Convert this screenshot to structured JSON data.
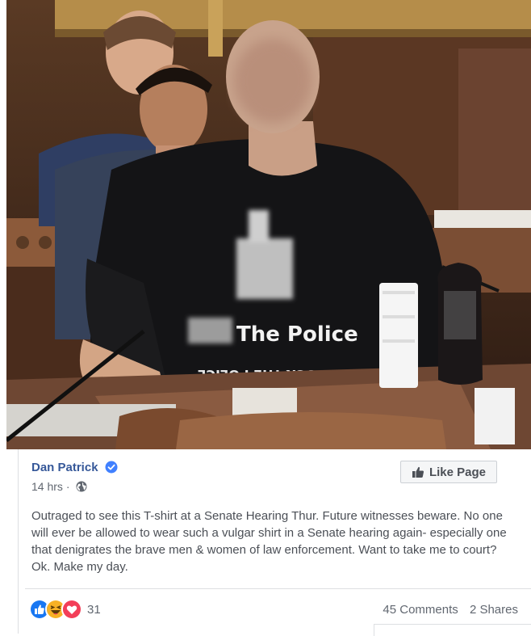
{
  "post": {
    "author": "Dan Patrick",
    "timestamp": "14 hrs",
    "separator": "·",
    "privacy_icon": "globe-icon",
    "verified_icon": "verified-badge-icon",
    "like_page_label": "Like Page",
    "text": "Outraged to see this T-shirt at a Senate Hearing Thur. Future witnesses beware. No one will ever be allowed to wear such a vulgar shirt in a Senate hearing again- especially one that denigrates the brave men & women of law enforcement. Want to take me to court? Ok. Make my day."
  },
  "photo": {
    "shirt_text": "The Police",
    "shirt_text_upside": "ƎƆI˥Od ƎH⊥ ʞƆ∩Ⅎ"
  },
  "engagement": {
    "reaction_icons": [
      "like-icon",
      "haha-icon",
      "love-icon"
    ],
    "reaction_count": "31",
    "comments": "45 Comments",
    "shares": "2 Shares"
  },
  "colors": {
    "link": "#365899",
    "text": "#4b4f56",
    "muted": "#616770",
    "like_blue": "#1877f2",
    "love_red": "#f33e58",
    "haha_yellow": "#f7b125"
  }
}
